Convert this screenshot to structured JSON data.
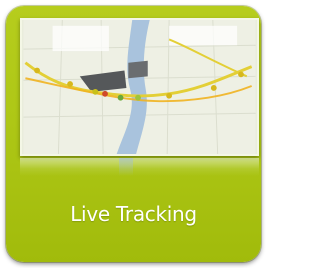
{
  "tile": {
    "label": "Live Tracking",
    "accent_color": "#aec716"
  },
  "thumbnail": {
    "icons": [
      "map-thumbnail-icon",
      "tracking-route-icon"
    ]
  }
}
